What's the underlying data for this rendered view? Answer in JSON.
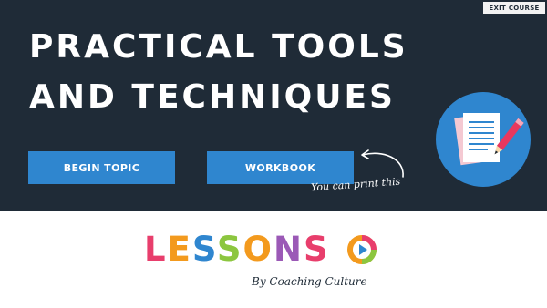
{
  "header": {
    "exit_label": "EXIT COURSE"
  },
  "hero": {
    "title_line1": "PRACTICAL TOOLS",
    "title_line2": "AND TECHNIQUES",
    "background_color": "#1f2b37"
  },
  "actions": {
    "begin_label": "BEGIN TOPIC",
    "workbook_label": "WORKBOOK",
    "print_note": "You can print this",
    "button_color": "#2f86cf"
  },
  "icons": {
    "document": "document-pencil-icon",
    "arrow": "curved-arrow-icon",
    "play": "play-icon"
  },
  "brand": {
    "letters": [
      {
        "char": "L",
        "color": "#e83e6c"
      },
      {
        "char": "E",
        "color": "#f39a1e"
      },
      {
        "char": "S",
        "color": "#2f86cf"
      },
      {
        "char": "S",
        "color": "#8cc63f"
      },
      {
        "char": "O",
        "color": "#f39a1e"
      },
      {
        "char": "N",
        "color": "#9b59b6"
      },
      {
        "char": "S",
        "color": "#e83e6c"
      }
    ],
    "tagline": "By Coaching Culture"
  }
}
